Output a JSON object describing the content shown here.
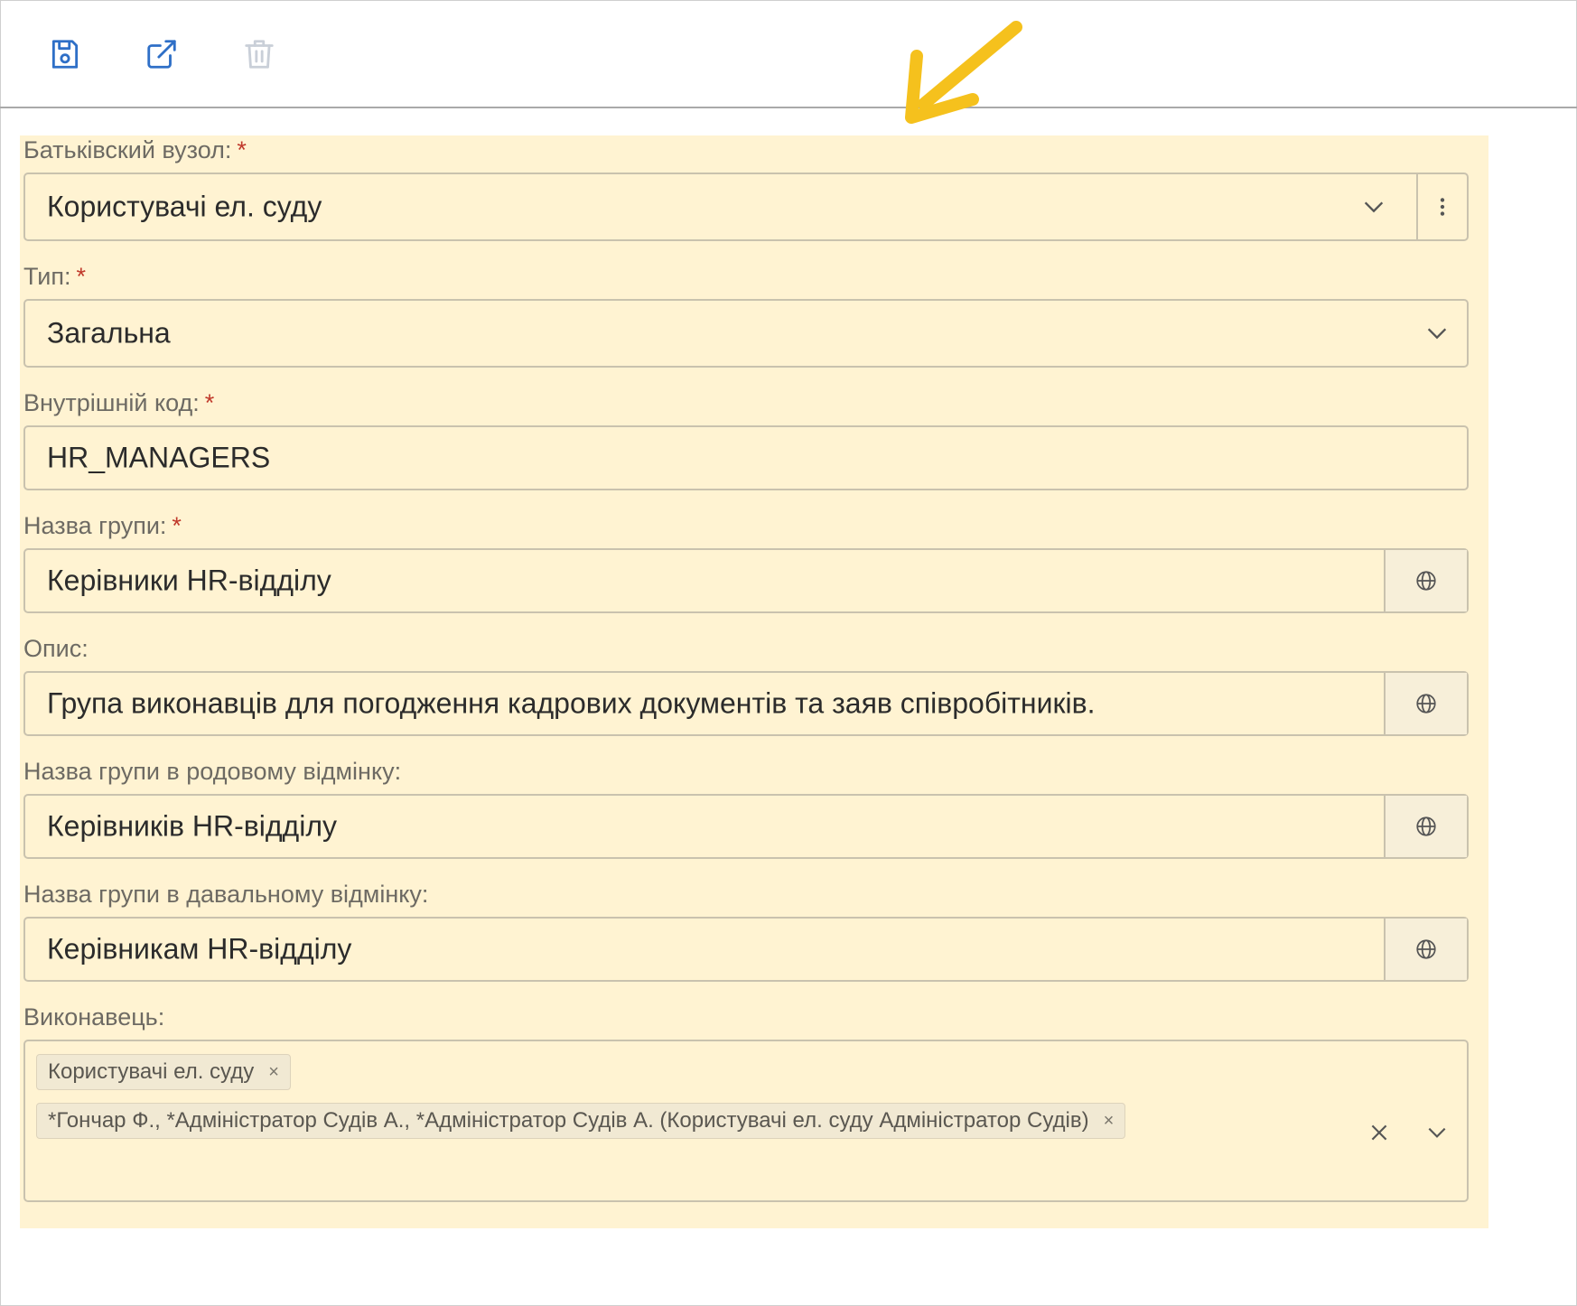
{
  "toolbar": {
    "buttons": [
      {
        "icon": "save-icon",
        "color": "#2e6fc7"
      },
      {
        "icon": "external-link-icon",
        "color": "#2e6fc7"
      },
      {
        "icon": "trash-icon",
        "color": "#c9cfd8"
      }
    ]
  },
  "colors": {
    "highlight": "#fff3d2",
    "required": "#c0392b",
    "arrow": "#f5c11d"
  },
  "form": {
    "parent": {
      "label": "Батьківский вузол:",
      "required": "*",
      "value": "Користувачі ел. суду"
    },
    "type": {
      "label": "Тип:",
      "required": "*",
      "value": "Загальна"
    },
    "code": {
      "label": "Внутрішній код:",
      "required": "*",
      "value": "HR_MANAGERS"
    },
    "name": {
      "label": "Назва групи:",
      "required": "*",
      "value": "Керівники HR-відділу"
    },
    "description": {
      "label": "Опис:",
      "value": "Група виконавців для погодження кадрових документів та заяв співробітників."
    },
    "genitive": {
      "label": "Назва групи в родовому відмінку:",
      "value": "Керівників HR-відділу"
    },
    "dative": {
      "label": "Назва групи в давальному відмінку:",
      "value": "Керівникам HR-відділу"
    },
    "executor": {
      "label": "Виконавець:",
      "tags": [
        {
          "text": "Користувачі ел. суду",
          "remove": "×"
        },
        {
          "text": "*Гончар Ф., *Адміністратор Судів А., *Адміністратор Судів А. (Користувачі ел. суду Адміністратор Судів)",
          "remove": "×"
        }
      ]
    }
  }
}
